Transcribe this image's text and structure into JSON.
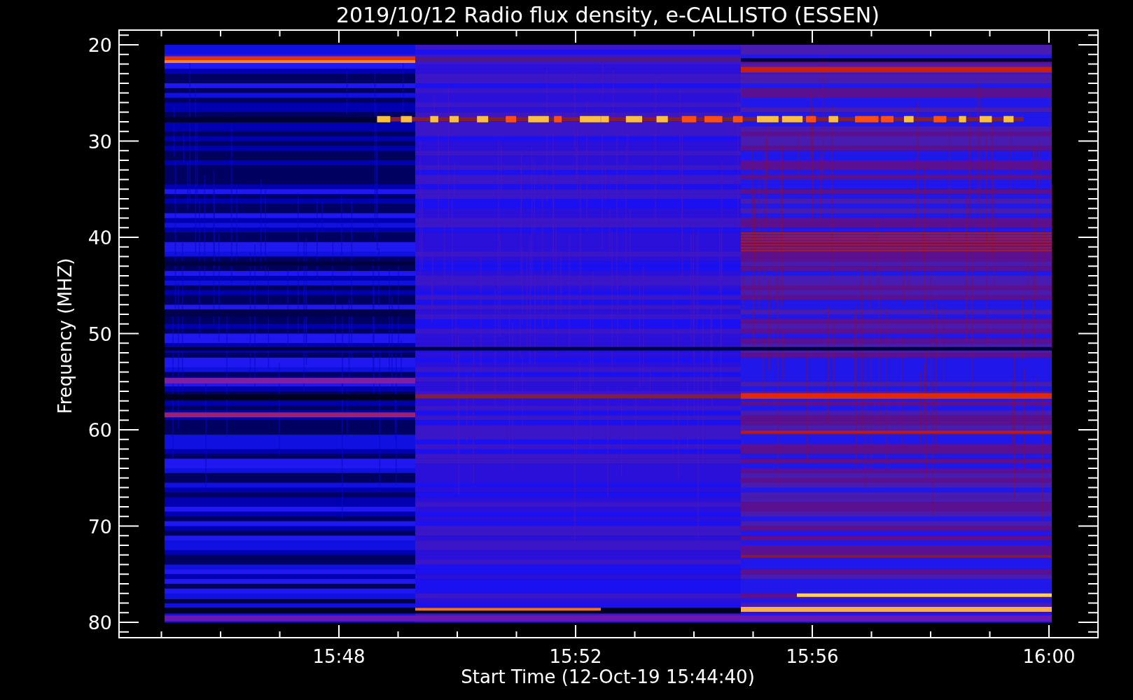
{
  "title": "2019/10/12  Radio flux density, e-CALLISTO (ESSEN)",
  "y_axis": {
    "label": "Frequency (MHZ)",
    "tick_labels": [
      "20",
      "30",
      "40",
      "50",
      "60",
      "70",
      "80"
    ]
  },
  "x_axis": {
    "label": "Start Time (12-Oct-19 15:44:40)",
    "tick_labels": [
      "15:48",
      "15:52",
      "15:56",
      "16:00"
    ]
  }
}
